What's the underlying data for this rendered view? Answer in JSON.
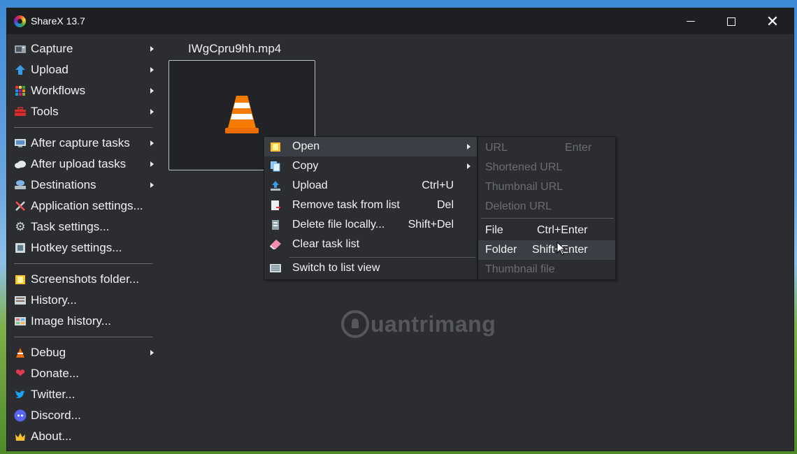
{
  "window": {
    "title": "ShareX 13.7"
  },
  "sidebar": {
    "groups": [
      [
        {
          "label": "Capture",
          "icon": "camera-icon",
          "submenu": true
        },
        {
          "label": "Upload",
          "icon": "upload-arrow-icon",
          "submenu": true
        },
        {
          "label": "Workflows",
          "icon": "grid-dots-icon",
          "submenu": true
        },
        {
          "label": "Tools",
          "icon": "toolbox-icon",
          "submenu": true
        }
      ],
      [
        {
          "label": "After capture tasks",
          "icon": "monitor-icon",
          "submenu": true
        },
        {
          "label": "After upload tasks",
          "icon": "cloud-icon",
          "submenu": true
        },
        {
          "label": "Destinations",
          "icon": "server-icon",
          "submenu": true
        },
        {
          "label": "Application settings...",
          "icon": "wrench-screwdriver-icon",
          "submenu": false
        },
        {
          "label": "Task settings...",
          "icon": "gear-icon",
          "submenu": false
        },
        {
          "label": "Hotkey settings...",
          "icon": "keyboard-key-icon",
          "submenu": false
        }
      ],
      [
        {
          "label": "Screenshots folder...",
          "icon": "folder-icon",
          "submenu": false
        },
        {
          "label": "History...",
          "icon": "history-list-icon",
          "submenu": false
        },
        {
          "label": "Image history...",
          "icon": "image-grid-icon",
          "submenu": false
        }
      ],
      [
        {
          "label": "Debug",
          "icon": "bug-icon",
          "submenu": true
        },
        {
          "label": "Donate...",
          "icon": "heart-icon",
          "submenu": false
        },
        {
          "label": "Twitter...",
          "icon": "twitter-bird-icon",
          "submenu": false
        },
        {
          "label": "Discord...",
          "icon": "discord-icon",
          "submenu": false
        },
        {
          "label": "About...",
          "icon": "crown-icon",
          "submenu": false
        }
      ]
    ]
  },
  "task": {
    "filename": "IWgCpru9hh.mp4",
    "thumbnail_icon": "vlc-cone-icon"
  },
  "context_menu": {
    "items": [
      {
        "label": "Open",
        "shortcut": "",
        "submenu": true,
        "icon": "open-folder-icon"
      },
      {
        "label": "Copy",
        "shortcut": "",
        "submenu": true,
        "icon": "copy-icon"
      },
      {
        "label": "Upload",
        "shortcut": "Ctrl+U",
        "submenu": false,
        "icon": "upload-tray-icon"
      },
      {
        "label": "Remove task from list",
        "shortcut": "Del",
        "submenu": false,
        "icon": "remove-doc-icon"
      },
      {
        "label": "Delete file locally...",
        "shortcut": "Shift+Del",
        "submenu": false,
        "icon": "trash-file-icon"
      },
      {
        "label": "Clear task list",
        "shortcut": "",
        "submenu": false,
        "icon": "eraser-icon"
      },
      {
        "label": "Switch to list view",
        "shortcut": "",
        "submenu": false,
        "icon": "list-view-icon"
      }
    ]
  },
  "submenu": {
    "items": [
      {
        "label": "URL",
        "shortcut": "Enter",
        "disabled": true
      },
      {
        "label": "Shortened URL",
        "shortcut": "",
        "disabled": true
      },
      {
        "label": "Thumbnail URL",
        "shortcut": "",
        "disabled": true
      },
      {
        "label": "Deletion URL",
        "shortcut": "",
        "disabled": true
      },
      {
        "label": "File",
        "shortcut": "Ctrl+Enter",
        "disabled": false
      },
      {
        "label": "Folder",
        "shortcut": "Shift+Enter",
        "disabled": false
      },
      {
        "label": "Thumbnail file",
        "shortcut": "",
        "disabled": true
      }
    ]
  },
  "watermark": {
    "text": "uantrimang"
  },
  "colors": {
    "window_bg": "#2b2d31",
    "titlebar_bg": "#1e1f22",
    "highlight": "#3b3e44",
    "disabled_text": "#6b6d72"
  }
}
